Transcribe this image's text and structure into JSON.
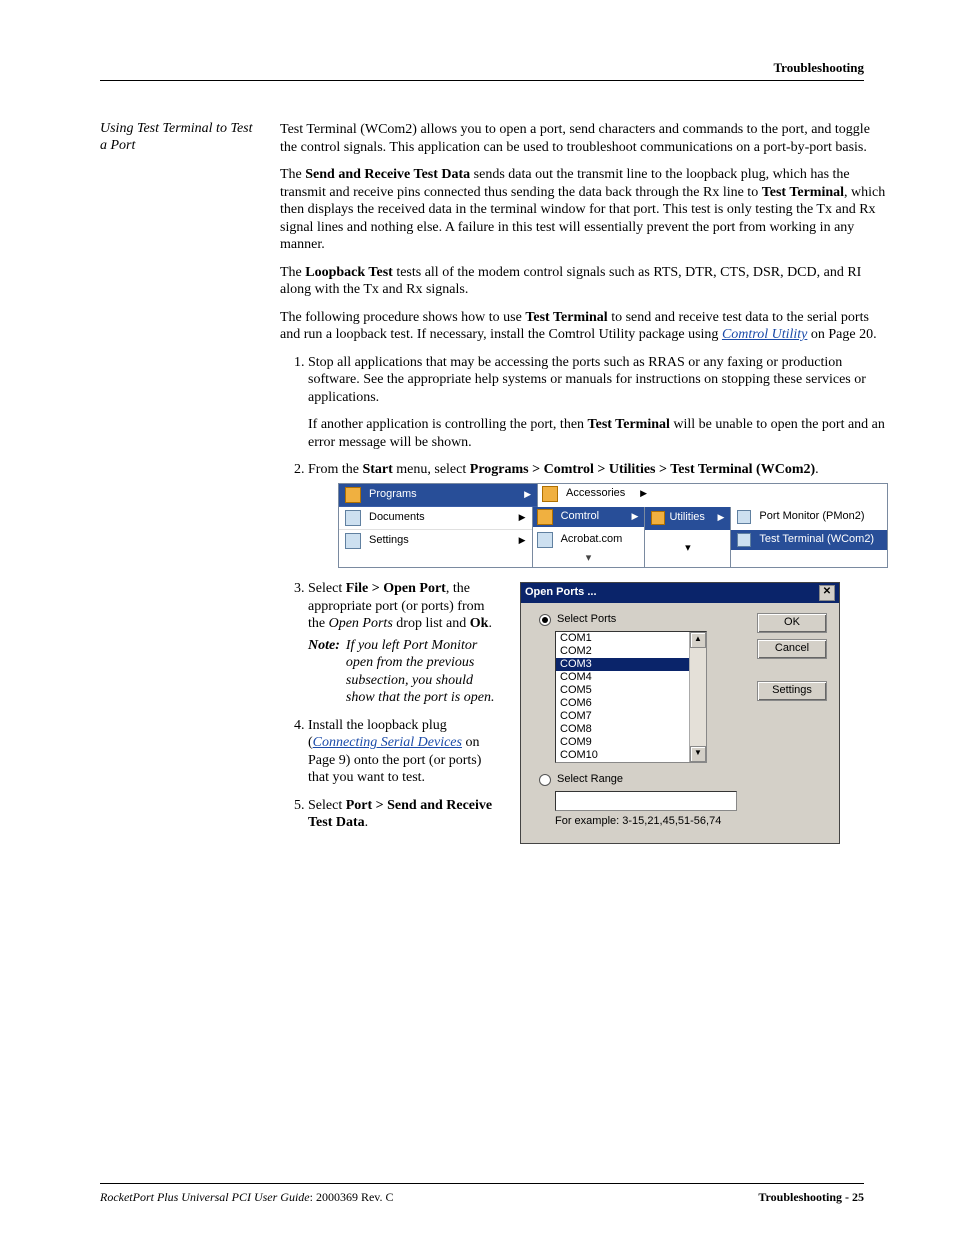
{
  "header": {
    "section": "Troubleshooting"
  },
  "sidebar_title": "Using Test Terminal to Test a Port",
  "paras": {
    "p1": "Test Terminal (WCom2) allows you to open a port, send characters and commands to the port, and toggle the control signals. This application can be used to troubleshoot communications on a port-by-port basis.",
    "p2a": "The ",
    "p2b": "Send and Receive Test Data",
    "p2c": " sends data out the transmit line to the loopback plug, which has the transmit and receive pins connected thus sending the data back through the Rx line to ",
    "p2d": "Test Terminal",
    "p2e": ", which then displays the received data in the terminal window for that port. This test is only testing the Tx and Rx signal lines and nothing else. A failure in this test will essentially prevent the port from working in any manner.",
    "p3a": "The ",
    "p3b": "Loopback Test",
    "p3c": " tests all of the modem control signals such as RTS, DTR, CTS, DSR, DCD, and RI along with the Tx and Rx signals.",
    "p4a": "The following procedure shows how to use ",
    "p4b": "Test Terminal",
    "p4c": " to send and receive test data to the serial ports and run a loopback test. If necessary, install the Comtrol Utility package using ",
    "p4link": "Comtrol Utility",
    "p4d": " on Page 20."
  },
  "steps": {
    "s1": "Stop all applications that may be accessing the ports such as RRAS or any faxing or production software. See the appropriate help systems or manuals for instructions on stopping these services or applications.",
    "s1b_a": "If another application is controlling the port, then ",
    "s1b_b": "Test Terminal",
    "s1b_c": " will be unable to open the port and an error message will be shown.",
    "s2a": "From the ",
    "s2b": "Start",
    "s2c": " menu, select ",
    "s2d": "Programs > Comtrol > Utilities > Test Terminal (WCom2)",
    "s2e": ".",
    "s3a": "Select ",
    "s3b": "File > Open Port",
    "s3c": ", the appropriate port (or ports) from the ",
    "s3d": "Open Ports",
    "s3e": " drop list and ",
    "s3f": "Ok",
    "s3g": ".",
    "note_label": "Note:",
    "note_body": "If you left Port Monitor open from the previous subsection, you should show that the port is open.",
    "s4a": "Install the loopback plug (",
    "s4link": "Connecting Serial Devices",
    "s4b": " on Page 9) onto the port (or ports) that you want to test.",
    "s5a": "Select ",
    "s5b": "Port > Send and Receive Test Data",
    "s5c": "."
  },
  "startmenu": {
    "left": [
      "Programs",
      "Documents",
      "Settings"
    ],
    "sub1": [
      "Accessories",
      "Comtrol",
      "Acrobat.com"
    ],
    "utilities": "Utilities",
    "sub2": [
      "Port Monitor (PMon2)",
      "Test Terminal (WCom2)"
    ]
  },
  "dialog": {
    "title": "Open Ports ...",
    "radio_ports": "Select Ports",
    "radio_range": "Select Range",
    "ports": [
      "COM1",
      "COM2",
      "COM3",
      "COM4",
      "COM5",
      "COM6",
      "COM7",
      "COM8",
      "COM9",
      "COM10"
    ],
    "selected": "COM3",
    "example": "For example: 3-15,21,45,51-56,74",
    "btn_ok": "OK",
    "btn_cancel": "Cancel",
    "btn_settings": "Settings"
  },
  "footer": {
    "guide": "RocketPort Plus Universal PCI User Guide",
    "rev": ": 2000369 Rev. C",
    "page": "Troubleshooting - 25"
  }
}
